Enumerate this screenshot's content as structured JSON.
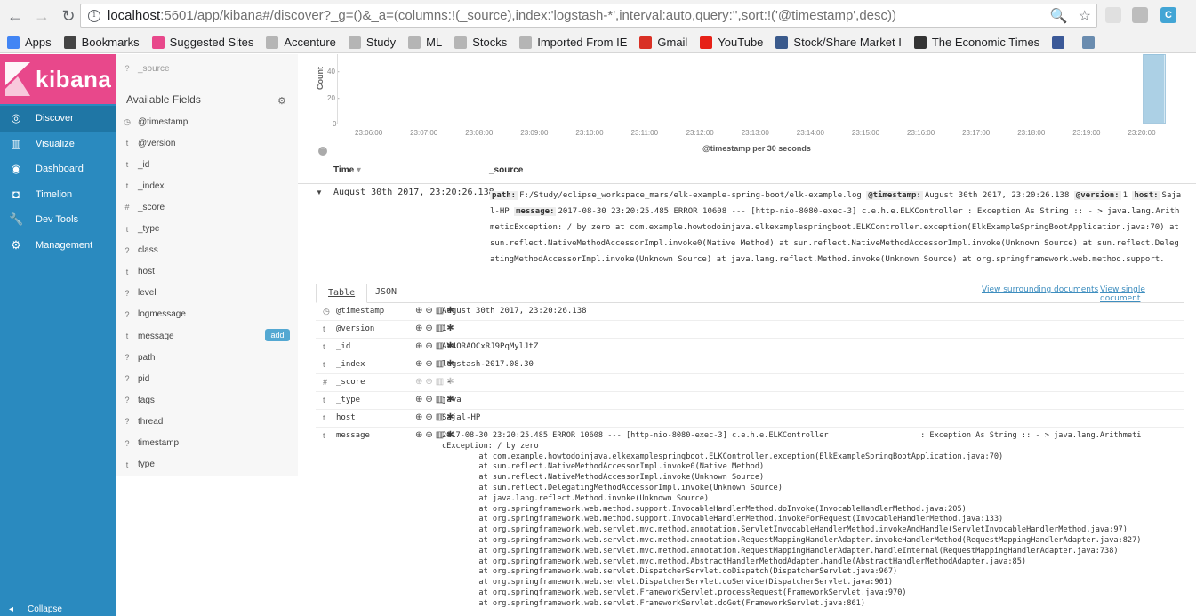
{
  "browser": {
    "url_host": "localhost",
    "url_rest": ":5601/app/kibana#/discover?_g=()&_a=(columns:!(_source),index:'logstash-*',interval:auto,query:'',sort:!('@timestamp',desc))",
    "bookmarks": [
      {
        "label": "Apps",
        "icon": "apps-grid-icon"
      },
      {
        "label": "Bookmarks",
        "icon": "star-icon"
      },
      {
        "label": "Suggested Sites",
        "icon": "suggested-icon"
      },
      {
        "label": "Accenture",
        "icon": "folder-icon"
      },
      {
        "label": "Study",
        "icon": "folder-icon"
      },
      {
        "label": "ML",
        "icon": "folder-icon"
      },
      {
        "label": "Stocks",
        "icon": "folder-icon"
      },
      {
        "label": "Imported From IE",
        "icon": "folder-icon"
      },
      {
        "label": "Gmail",
        "icon": "gmail-icon"
      },
      {
        "label": "YouTube",
        "icon": "youtube-icon"
      },
      {
        "label": "Stock/Share Market I",
        "icon": "stock-icon"
      },
      {
        "label": "The Economic Times",
        "icon": "et-icon"
      },
      {
        "label": "",
        "icon": "facebook-icon"
      },
      {
        "label": "",
        "icon": "misc-icon"
      }
    ]
  },
  "kibana": {
    "logo_text": "kibana",
    "nav": [
      {
        "label": "Discover",
        "icon": "compass-icon",
        "glyph": "◎"
      },
      {
        "label": "Visualize",
        "icon": "bar-chart-icon",
        "glyph": "▥"
      },
      {
        "label": "Dashboard",
        "icon": "dashboard-icon",
        "glyph": "◉"
      },
      {
        "label": "Timelion",
        "icon": "timelion-icon",
        "glyph": "◘"
      },
      {
        "label": "Dev Tools",
        "icon": "wrench-icon",
        "glyph": "🔧"
      },
      {
        "label": "Management",
        "icon": "gear-icon",
        "glyph": "⚙"
      }
    ],
    "collapse_label": "Collapse"
  },
  "fields": {
    "selected": [
      {
        "type": "?",
        "name": "_source"
      }
    ],
    "available_title": "Available Fields",
    "available": [
      {
        "type": "◷",
        "name": "@timestamp"
      },
      {
        "type": "t",
        "name": "@version"
      },
      {
        "type": "t",
        "name": "_id"
      },
      {
        "type": "t",
        "name": "_index"
      },
      {
        "type": "#",
        "name": "_score"
      },
      {
        "type": "t",
        "name": "_type"
      },
      {
        "type": "?",
        "name": "class"
      },
      {
        "type": "t",
        "name": "host"
      },
      {
        "type": "?",
        "name": "level"
      },
      {
        "type": "?",
        "name": "logmessage"
      },
      {
        "type": "t",
        "name": "message"
      },
      {
        "type": "?",
        "name": "path"
      },
      {
        "type": "?",
        "name": "pid"
      },
      {
        "type": "?",
        "name": "tags"
      },
      {
        "type": "?",
        "name": "thread"
      },
      {
        "type": "?",
        "name": "timestamp"
      },
      {
        "type": "t",
        "name": "type"
      }
    ],
    "add_label": "add"
  },
  "chart": {
    "ylabel": "Count",
    "yticks": [
      "40 -",
      "20 -",
      "0"
    ],
    "xticks": [
      "23:06:00",
      "23:07:00",
      "23:08:00",
      "23:09:00",
      "23:10:00",
      "23:11:00",
      "23:12:00",
      "23:13:00",
      "23:14:00",
      "23:15:00",
      "23:16:00",
      "23:17:00",
      "23:18:00",
      "23:19:00",
      "23:20:00"
    ],
    "caption": "@timestamp per 30 seconds"
  },
  "table": {
    "col_time": "Time",
    "col_source": "_source",
    "row_time": "August 30th 2017, 23:20:26.138",
    "source_pairs": [
      {
        "k": "path:",
        "v": "F:/Study/eclipse_workspace_mars/elk-example-spring-boot/elk-example.log"
      },
      {
        "k": "@timestamp:",
        "v": "August 30th 2017, 23:20:26.138"
      },
      {
        "k": "@version:",
        "v": "1"
      },
      {
        "k": "host:",
        "v": "Sajal-HP"
      },
      {
        "k": "message:",
        "v": "2017-08-30 23:20:25.485 ERROR 10608 --- [http-nio-8080-exec-3] c.e.h.e.ELKController : Exception As String :: - > java.lang.ArithmeticException: / by zero at com.example.howtodoinjava.elkexamplespringboot.ELKController.exception(ElkExampleSpringBootApplication.java:70) at sun.reflect.NativeMethodAccessorImpl.invoke0(Native Method) at sun.reflect.NativeMethodAccessorImpl.invoke(Unknown Source) at sun.reflect.DelegatingMethodAccessorImpl.invoke(Unknown Source) at java.lang.reflect.Method.invoke(Unknown Source) at org.springframework.web.method.support."
      }
    ]
  },
  "detail": {
    "tab_table": "Table",
    "tab_json": "JSON",
    "link_surrounding": "View surrounding documents",
    "link_single": "View single document",
    "rows": [
      {
        "type": "◷",
        "name": "@timestamp",
        "value": "August 30th 2017, 23:20:26.138"
      },
      {
        "type": "t",
        "name": "@version",
        "value": "1"
      },
      {
        "type": "t",
        "name": "_id",
        "value": "AV4ORAOCxRJ9PqMylJtZ"
      },
      {
        "type": "t",
        "name": "_index",
        "value": "logstash-2017.08.30"
      },
      {
        "type": "#",
        "name": "_score",
        "value": " -"
      },
      {
        "type": "t",
        "name": "_type",
        "value": "java"
      },
      {
        "type": "t",
        "name": "host",
        "value": "Sajal-HP"
      }
    ],
    "message_row": {
      "type": "t",
      "name": "message",
      "lines": [
        "2017-08-30 23:20:25.485 ERROR 10608 --- [http-nio-8080-exec-3] c.e.h.e.ELKController                    : Exception As String :: - > java.lang.Arithmeti",
        "cException: / by zero",
        "        at com.example.howtodoinjava.elkexamplespringboot.ELKController.exception(ElkExampleSpringBootApplication.java:70)",
        "        at sun.reflect.NativeMethodAccessorImpl.invoke0(Native Method)",
        "        at sun.reflect.NativeMethodAccessorImpl.invoke(Unknown Source)",
        "        at sun.reflect.DelegatingMethodAccessorImpl.invoke(Unknown Source)",
        "        at java.lang.reflect.Method.invoke(Unknown Source)",
        "        at org.springframework.web.method.support.InvocableHandlerMethod.doInvoke(InvocableHandlerMethod.java:205)",
        "        at org.springframework.web.method.support.InvocableHandlerMethod.invokeForRequest(InvocableHandlerMethod.java:133)",
        "        at org.springframework.web.servlet.mvc.method.annotation.ServletInvocableHandlerMethod.invokeAndHandle(ServletInvocableHandlerMethod.java:97)",
        "        at org.springframework.web.servlet.mvc.method.annotation.RequestMappingHandlerAdapter.invokeHandlerMethod(RequestMappingHandlerAdapter.java:827)",
        "        at org.springframework.web.servlet.mvc.method.annotation.RequestMappingHandlerAdapter.handleInternal(RequestMappingHandlerAdapter.java:738)",
        "        at org.springframework.web.servlet.mvc.method.AbstractHandlerMethodAdapter.handle(AbstractHandlerMethodAdapter.java:85)",
        "        at org.springframework.web.servlet.DispatcherServlet.doDispatch(DispatcherServlet.java:967)",
        "        at org.springframework.web.servlet.DispatcherServlet.doService(DispatcherServlet.java:901)",
        "        at org.springframework.web.servlet.FrameworkServlet.processRequest(FrameworkServlet.java:970)",
        "        at org.springframework.web.servlet.FrameworkServlet.doGet(FrameworkServlet.java:861)"
      ]
    }
  },
  "colors": {
    "kibana_pink": "#e8488b",
    "kibana_nav_blue": "#2a8abf",
    "link_blue": "#3e8ebf",
    "add_button": "#54a8d2"
  }
}
